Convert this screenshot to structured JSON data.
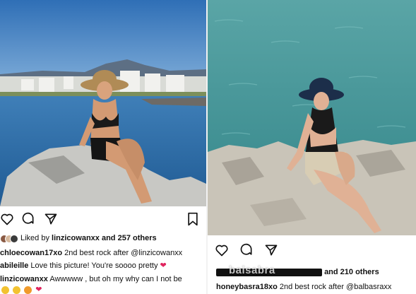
{
  "colors": {
    "heart": "#e0245e",
    "text": "#111111",
    "link": "#111111"
  },
  "left_post": {
    "icons": [
      "heart-icon",
      "comment-icon",
      "share-icon",
      "bookmark-icon"
    ],
    "liked_by_prefix": "Liked by",
    "liked_by_user": "linzicowanxx",
    "liked_by_suffix": "and 257 others",
    "comments": [
      {
        "user": "chloecowan17xo",
        "text": "2nd best rock after @linzicowanxx"
      },
      {
        "user": "abileille",
        "text": "Love this picture! You're soooo pretty",
        "trailing_icon": "heart-icon"
      },
      {
        "user": "linzicowanxx",
        "text": "Awwwww , but oh my why can I not be"
      }
    ]
  },
  "right_post": {
    "icons": [
      "heart-icon",
      "comment-icon",
      "share-icon"
    ],
    "liked_by_suffix": "and 210 others",
    "watermark": "balsabra",
    "comments": [
      {
        "user": "honeybasra18xo",
        "text": "2nd best rock after @balbasraxx"
      }
    ]
  }
}
